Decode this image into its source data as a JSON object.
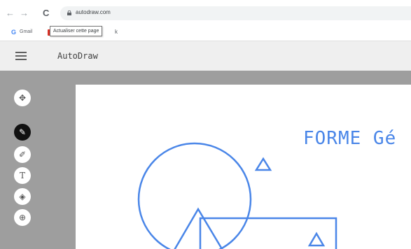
{
  "browser": {
    "back_icon": "←",
    "forward_icon": "→",
    "reload_icon": "C",
    "url": "autodraw.com",
    "bookmarks": [
      {
        "icon": "G",
        "label": "Gmail"
      },
      {
        "icon": "red-bookmark-icon",
        "label": "k"
      }
    ],
    "tooltip": "Actualiser cette page"
  },
  "app": {
    "title": "AutoDraw"
  },
  "toolbar": {
    "tools": [
      {
        "name": "move-tool",
        "glyph": "✥"
      },
      {
        "name": "autodraw-tool",
        "glyph": "✎",
        "active": true
      },
      {
        "name": "draw-tool",
        "glyph": "✐"
      },
      {
        "name": "type-tool",
        "glyph": "T"
      },
      {
        "name": "fill-tool",
        "glyph": "◈"
      },
      {
        "name": "shape-tool",
        "glyph": "⊕"
      }
    ]
  },
  "canvas": {
    "title": "FORME Gé",
    "stroke_color": "#4a86e8"
  },
  "colors": {
    "workspace": "#9e9e9e",
    "header": "#efefef",
    "accent": "#4a86e8"
  }
}
